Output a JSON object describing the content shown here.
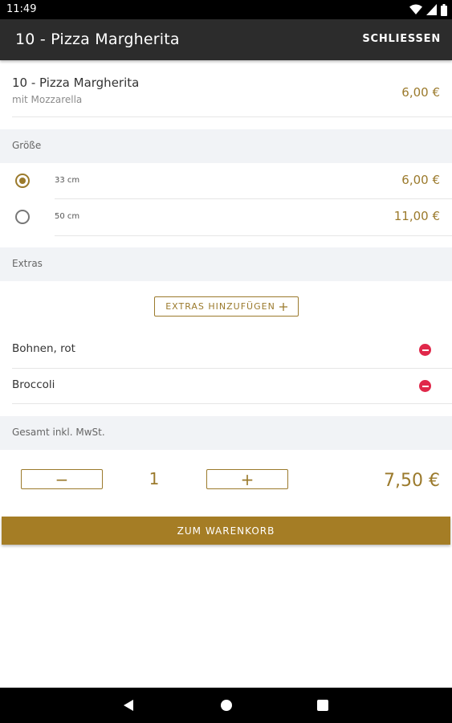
{
  "status_bar": {
    "time": "11:49"
  },
  "app_bar": {
    "title": "10 - Pizza Margherita",
    "close_label": "SCHLIESSEN"
  },
  "product": {
    "name": "10 - Pizza Margherita",
    "description": "mit Mozzarella",
    "price": "6,00 €"
  },
  "size_section": {
    "header": "Größe",
    "options": [
      {
        "label": "33 cm",
        "price": "6,00 €",
        "selected": true
      },
      {
        "label": "50 cm",
        "price": "11,00 €",
        "selected": false
      }
    ]
  },
  "extras_section": {
    "header": "Extras",
    "add_button_label": "EXTRAS HINZUFÜGEN",
    "items": [
      {
        "name": "Bohnen, rot"
      },
      {
        "name": "Broccoli"
      }
    ]
  },
  "total_section": {
    "header": "Gesamt inkl. MwSt.",
    "minus_label": "−",
    "plus_label": "+",
    "quantity": "1",
    "total_price": "7,50 €"
  },
  "cart_button_label": "ZUM WARENKORB",
  "colors": {
    "accent": "#a57d25",
    "remove": "#e0284a",
    "app_bar": "#2c2c2c",
    "section_bg": "#f1f3f6"
  },
  "icons": [
    "wifi-icon",
    "signal-icon",
    "battery-icon",
    "plus-icon",
    "remove-icon",
    "back-icon",
    "home-icon",
    "recents-icon"
  ]
}
